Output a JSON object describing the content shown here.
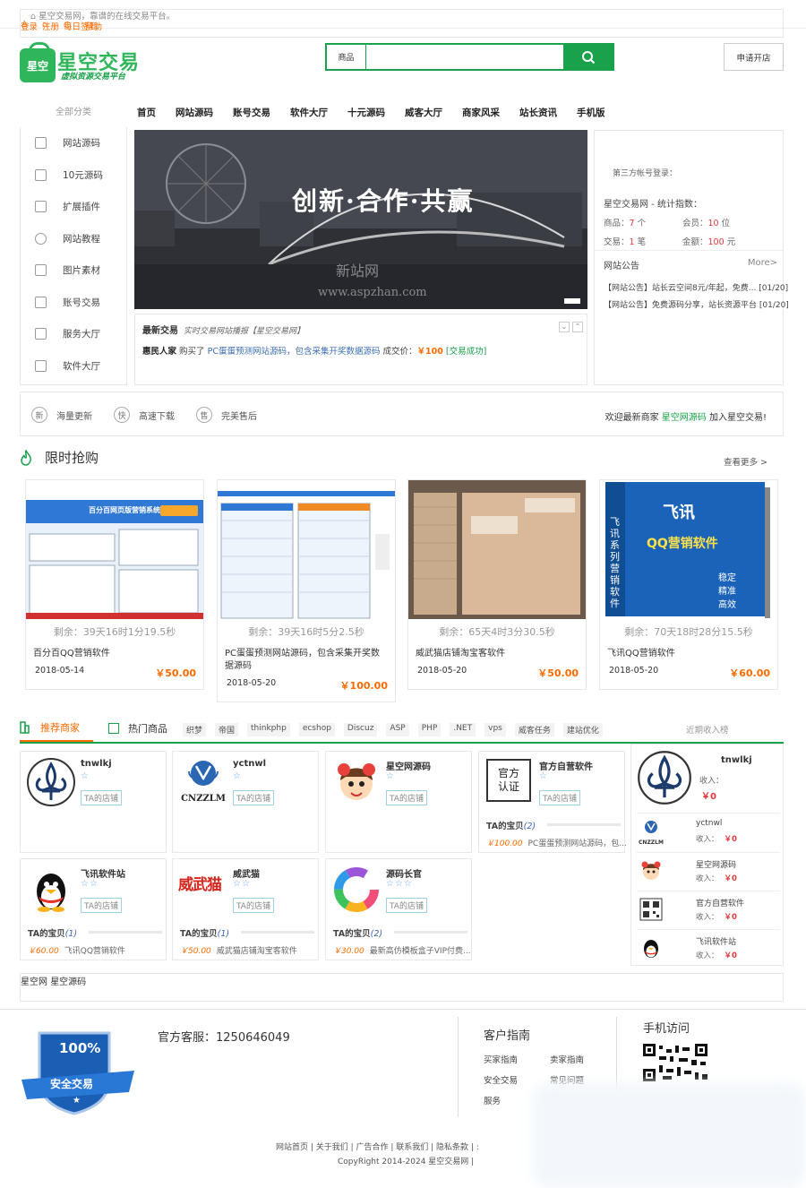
{
  "topbar": {
    "welcome": "星空交易网，靠谱的在线交易平台。",
    "login": "登录",
    "register": "注册",
    "checkin": "每日签到",
    "help": "帮助"
  },
  "logo": {
    "bag": "星空",
    "name": "星空交易",
    "slogan": "虚拟资源交易平台"
  },
  "search": {
    "type": "商品",
    "placeholder": ""
  },
  "open_shop": "申请开店",
  "nav": {
    "all": "全部分类",
    "items": [
      "首页",
      "网站源码",
      "账号交易",
      "软件大厅",
      "十元源码",
      "威客大厅",
      "商家风采",
      "站长资讯",
      "手机版"
    ]
  },
  "categories": [
    "网站源码",
    "10元源码",
    "扩展插件",
    "网站教程",
    "图片素材",
    "账号交易",
    "服务大厅",
    "软件大厅"
  ],
  "banner": {
    "title": "创新·合作·共赢",
    "wm1": "新站网",
    "wm2": "www.aspzhan.com"
  },
  "latest": {
    "title": "最新交易",
    "sub": "实时交易网站播报【星空交易网】",
    "buyer": "惠民人家",
    "action": "购买了",
    "product": "PC蛋蛋预测网站源码，包含采集开奖数据源码",
    "price_label": "成交价：",
    "price": "￥100",
    "status": "[交易成功]"
  },
  "side": {
    "third_login": "第三方帐号登录：",
    "stat_title": "星空交易网 - 统计指数：",
    "goods_label": "商品：",
    "goods": "7",
    "goods_unit": "个",
    "members_label": "会员：",
    "members": "10",
    "members_unit": "位",
    "trades_label": "交易：",
    "trades": "1",
    "trades_unit": "笔",
    "amount_label": "金额：",
    "amount": "100",
    "amount_unit": "元",
    "notice_title": "网站公告",
    "more": "More>",
    "notices": [
      "【网站公告】站长云空间8元/年起，免费... [01/20]",
      "【网站公告】免费源码分享，站长资源平台 [01/20]"
    ]
  },
  "service": {
    "items": [
      {
        "ic": "新",
        "t": "海量更新"
      },
      {
        "ic": "快",
        "t": "高速下载"
      },
      {
        "ic": "售",
        "t": "完美售后"
      }
    ],
    "welcome_pre": "欢迎最新商家",
    "welcome_shop": "星空网源码",
    "welcome_post": "加入星空交易!"
  },
  "flash": {
    "title": "限时抢购",
    "more": "查看更多 >",
    "products": [
      {
        "countdown": "剩余：39天16时1分19.5秒",
        "name": "百分百QQ营销软件",
        "date": "2018-05-14",
        "price": "￥50.00",
        "shot_title": "百分百网页版营销系统"
      },
      {
        "countdown": "剩余：39天16时5分2.5秒",
        "name": "PC蛋蛋预测网站源码，包含采集开奖数据源码",
        "date": "2018-05-20",
        "price": "￥100.00"
      },
      {
        "countdown": "剩余：65天4时3分30.5秒",
        "name": "威武猫店铺淘宝客软件",
        "date": "2018-05-20",
        "price": "￥50.00"
      },
      {
        "countdown": "剩余：70天18时28分15.5秒",
        "name": "飞讯QQ营销软件",
        "date": "2018-05-20",
        "price": "￥60.00",
        "box_brand": "飞讯",
        "box_title": "QQ营销软件",
        "box_side": "飞讯系列营销软件",
        "box_items": [
          "稳定",
          "精准",
          "高效"
        ]
      }
    ]
  },
  "merchants_hd": {
    "rec": "推荐商家",
    "hot": "热门商品",
    "tags": [
      "织梦",
      "帝国",
      "thinkphp",
      "ecshop",
      "Discuz",
      "ASP",
      "PHP",
      ".NET",
      "vps",
      "威客任务",
      "建站优化"
    ],
    "rank": "近期收入榜"
  },
  "merchants": [
    {
      "name": "tnwlkj",
      "stars": "☆",
      "shop": "TA的店铺"
    },
    {
      "name": "yctnwl",
      "stars": "☆",
      "shop": "TA的店铺",
      "logo_text": "CNZZLM"
    },
    {
      "name": "星空网源码",
      "stars": "☆",
      "shop": "TA的店铺"
    },
    {
      "name": "官方自营软件",
      "stars": "☆",
      "shop": "TA的店铺",
      "seal": "官方认证",
      "bao": "TA的宝贝",
      "bao_n": "(2)",
      "item_price": "￥100.00",
      "item_name": "PC蛋蛋预测网站源码，包..."
    },
    {
      "name": "飞讯软件站",
      "stars": "☆☆",
      "shop": "TA的店铺",
      "bao": "TA的宝贝",
      "bao_n": "(1)",
      "item_price": "￥60.00",
      "item_name": "飞讯QQ营销软件"
    },
    {
      "name": "威武猫",
      "stars": "☆☆",
      "shop": "TA的店铺",
      "logo_text": "威武猫",
      "bao": "TA的宝贝",
      "bao_n": "(1)",
      "item_price": "￥50.00",
      "item_name": "威武猫店铺淘宝客软件"
    },
    {
      "name": "源码长官",
      "stars": "☆☆☆",
      "shop": "TA的店铺",
      "bao": "TA的宝贝",
      "bao_n": "(2)",
      "item_price": "￥30.00",
      "item_name": "最新高仿模板盒子VIP付费..."
    }
  ],
  "rank": {
    "top_name": "tnwlkj",
    "income_label": "收入：",
    "top_income": "￥0",
    "items": [
      {
        "name": "yctnwl",
        "logo_text": "CNZZLM",
        "income": "￥0"
      },
      {
        "name": "星空网源码",
        "income": "￥0"
      },
      {
        "name": "官方自营软件",
        "income": "￥0"
      },
      {
        "name": "飞讯软件站",
        "income": "￥0"
      }
    ]
  },
  "links": [
    "星空网",
    "星空源码"
  ],
  "footer": {
    "badge_pct": "100%",
    "badge_text": "安全交易",
    "tel": "官方客服：1250646049",
    "guide_title": "客户指南",
    "guide": [
      "买家指南",
      "卖家指南",
      "安全交易",
      "常见问题",
      "服务"
    ],
    "mobile": "手机访问",
    "links": "网站首页 | 关于我们 | 广告合作 | 联系我们 | 隐私条款 | :",
    "copyright": "CopyRight 2014-2024 星空交易网 |"
  },
  "colors": {
    "brand": "#1aa14b",
    "price": "#ff6a00",
    "accent": "#e4393c"
  }
}
